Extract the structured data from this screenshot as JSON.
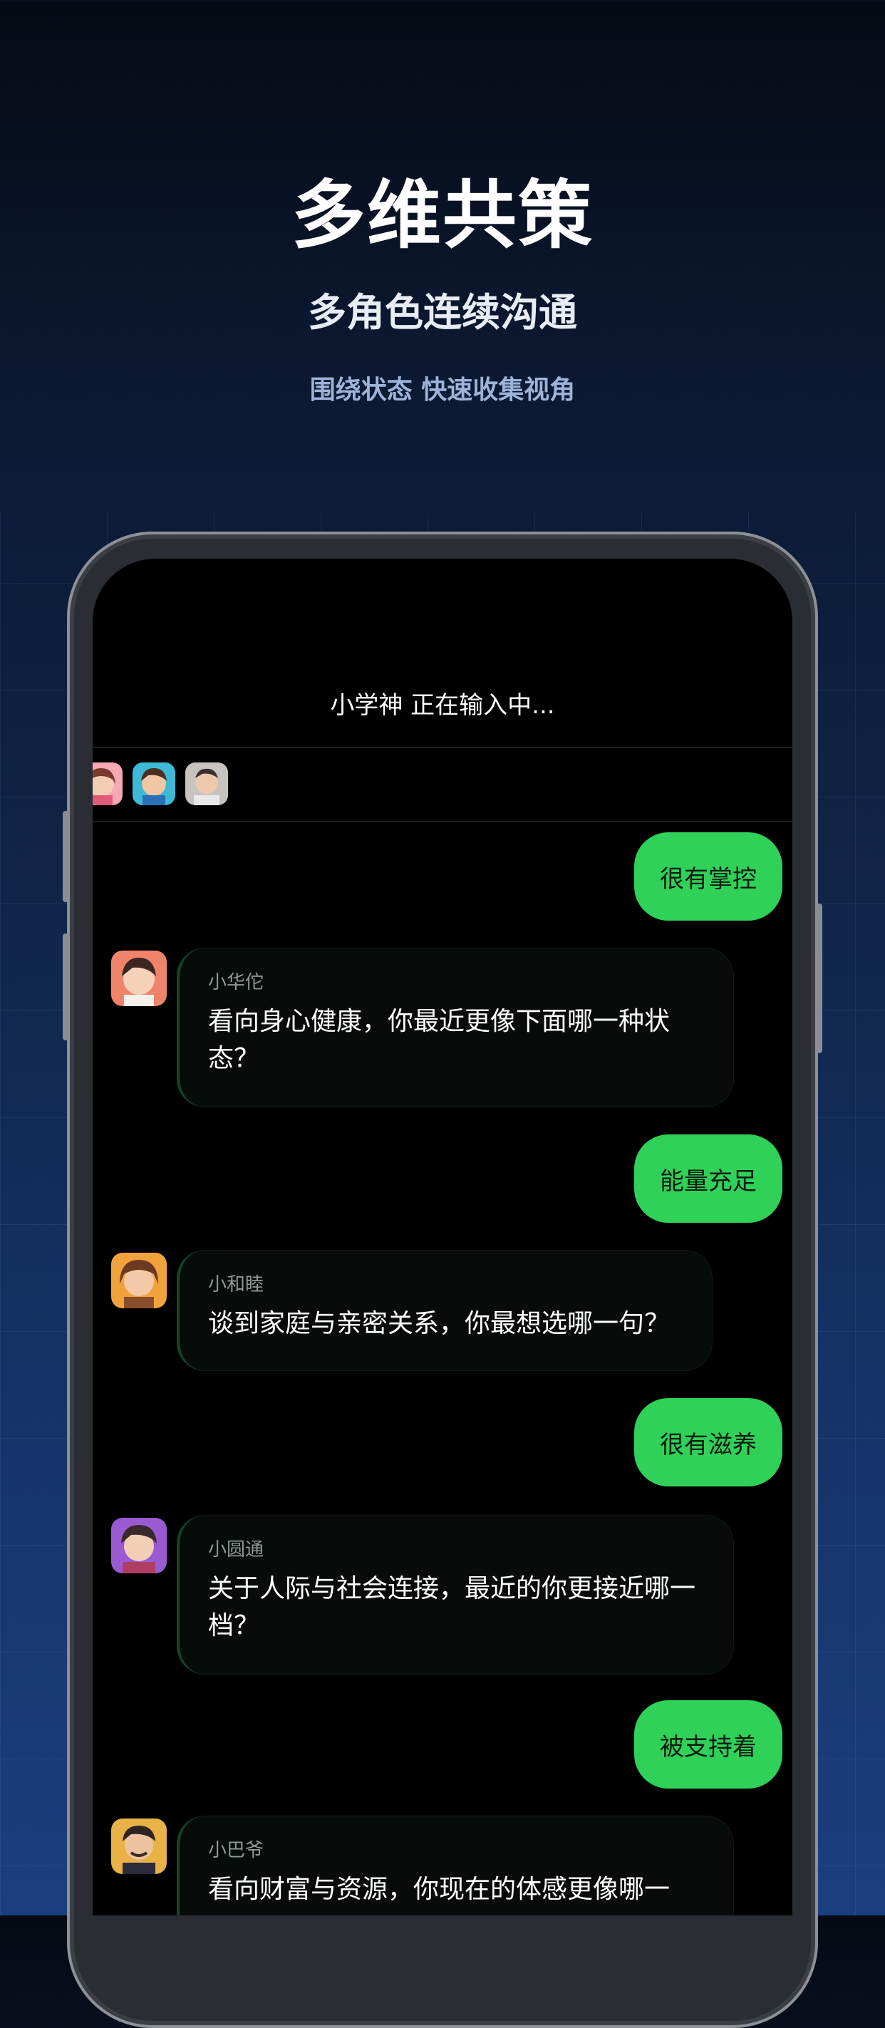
{
  "hero": {
    "title": "多维共策",
    "subtitle": "多角色连续沟通",
    "tagline": "围绕状态 快速收集视角"
  },
  "chat": {
    "status": "小学神 正在输入中...",
    "participants": [
      "avatar-girl",
      "avatar-boy",
      "avatar-man"
    ],
    "messages": [
      {
        "from": "me",
        "text": "很有掌控"
      },
      {
        "from": "bot",
        "name": "小华佗",
        "text": "看向身心健康，你最近更像下面哪一种状态？",
        "avatar": "avatar-huatuo"
      },
      {
        "from": "me",
        "text": "能量充足"
      },
      {
        "from": "bot",
        "name": "小和睦",
        "text": "谈到家庭与亲密关系，你最想选哪一句？",
        "avatar": "avatar-hemu"
      },
      {
        "from": "me",
        "text": "很有滋养"
      },
      {
        "from": "bot",
        "name": "小圆通",
        "text": "关于人际与社会连接，最近的你更接近哪一档？",
        "avatar": "avatar-yuantong"
      },
      {
        "from": "me",
        "text": "被支持着"
      },
      {
        "from": "bot",
        "name": "小巴爷",
        "text": "看向财富与资源，你现在的体感更像哪一",
        "avatar": "avatar-baye"
      }
    ]
  },
  "colors": {
    "accent_green": "#2fd158",
    "background_top": "#060a14",
    "background_bottom": "#1b3f7e"
  }
}
